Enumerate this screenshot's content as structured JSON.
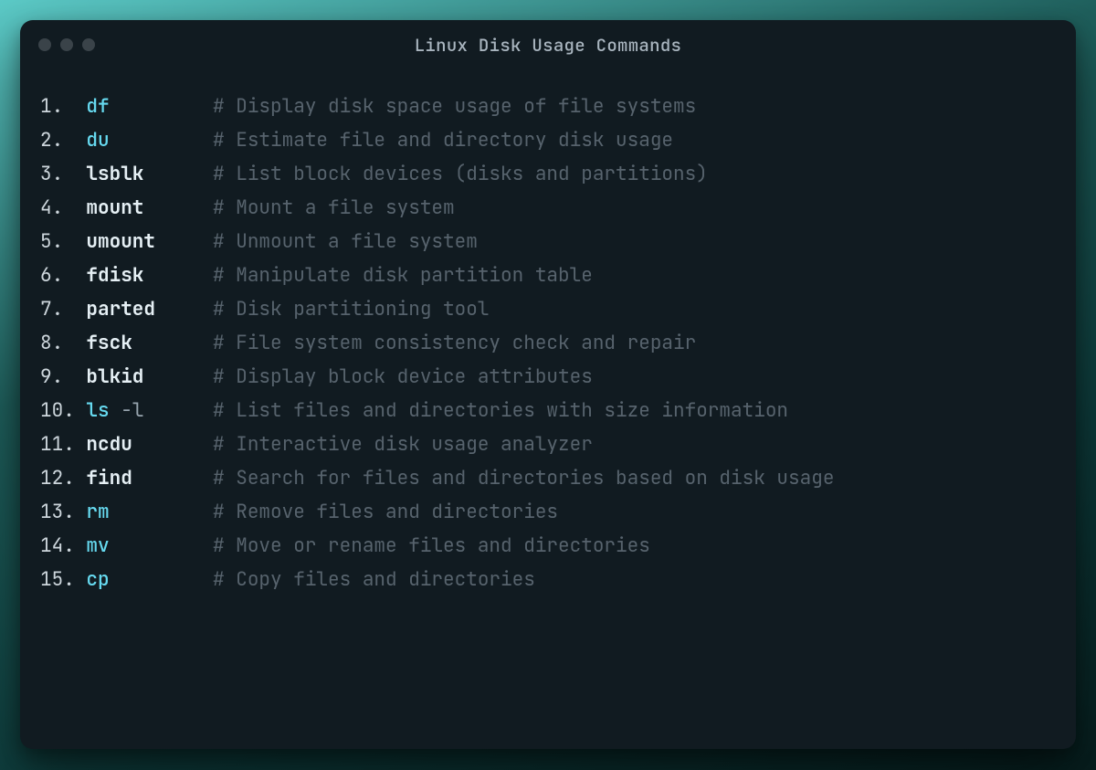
{
  "window": {
    "title": "Linux Disk Usage Commands"
  },
  "commands": [
    {
      "num": "1.",
      "cmd": "df",
      "style": "builtin",
      "flag": "",
      "comment": "# Display disk space usage of file systems"
    },
    {
      "num": "2.",
      "cmd": "du",
      "style": "builtin",
      "flag": "",
      "comment": "# Estimate file and directory disk usage"
    },
    {
      "num": "3.",
      "cmd": "lsblk",
      "style": "bright",
      "flag": "",
      "comment": "# List block devices (disks and partitions)"
    },
    {
      "num": "4.",
      "cmd": "mount",
      "style": "bright",
      "flag": "",
      "comment": "# Mount a file system"
    },
    {
      "num": "5.",
      "cmd": "umount",
      "style": "bright",
      "flag": "",
      "comment": "# Unmount a file system"
    },
    {
      "num": "6.",
      "cmd": "fdisk",
      "style": "bright",
      "flag": "",
      "comment": "# Manipulate disk partition table"
    },
    {
      "num": "7.",
      "cmd": "parted",
      "style": "bright",
      "flag": "",
      "comment": "# Disk partitioning tool"
    },
    {
      "num": "8.",
      "cmd": "fsck",
      "style": "bright",
      "flag": "",
      "comment": "# File system consistency check and repair"
    },
    {
      "num": "9.",
      "cmd": "blkid",
      "style": "bright",
      "flag": "",
      "comment": "# Display block device attributes"
    },
    {
      "num": "10.",
      "cmd": "ls",
      "style": "builtin",
      "flag": "-l",
      "comment": "# List files and directories with size information"
    },
    {
      "num": "11.",
      "cmd": "ncdu",
      "style": "bright",
      "flag": "",
      "comment": "# Interactive disk usage analyzer"
    },
    {
      "num": "12.",
      "cmd": "find",
      "style": "bright",
      "flag": "",
      "comment": "# Search for files and directories based on disk usage"
    },
    {
      "num": "13.",
      "cmd": "rm",
      "style": "builtin",
      "flag": "",
      "comment": "# Remove files and directories"
    },
    {
      "num": "14.",
      "cmd": "mv",
      "style": "builtin",
      "flag": "",
      "comment": "# Move or rename files and directories"
    },
    {
      "num": "15.",
      "cmd": "cp",
      "style": "builtin",
      "flag": "",
      "comment": "# Copy files and directories"
    }
  ],
  "layout": {
    "num_col_pad": 3,
    "cmd_col_width": 11
  }
}
